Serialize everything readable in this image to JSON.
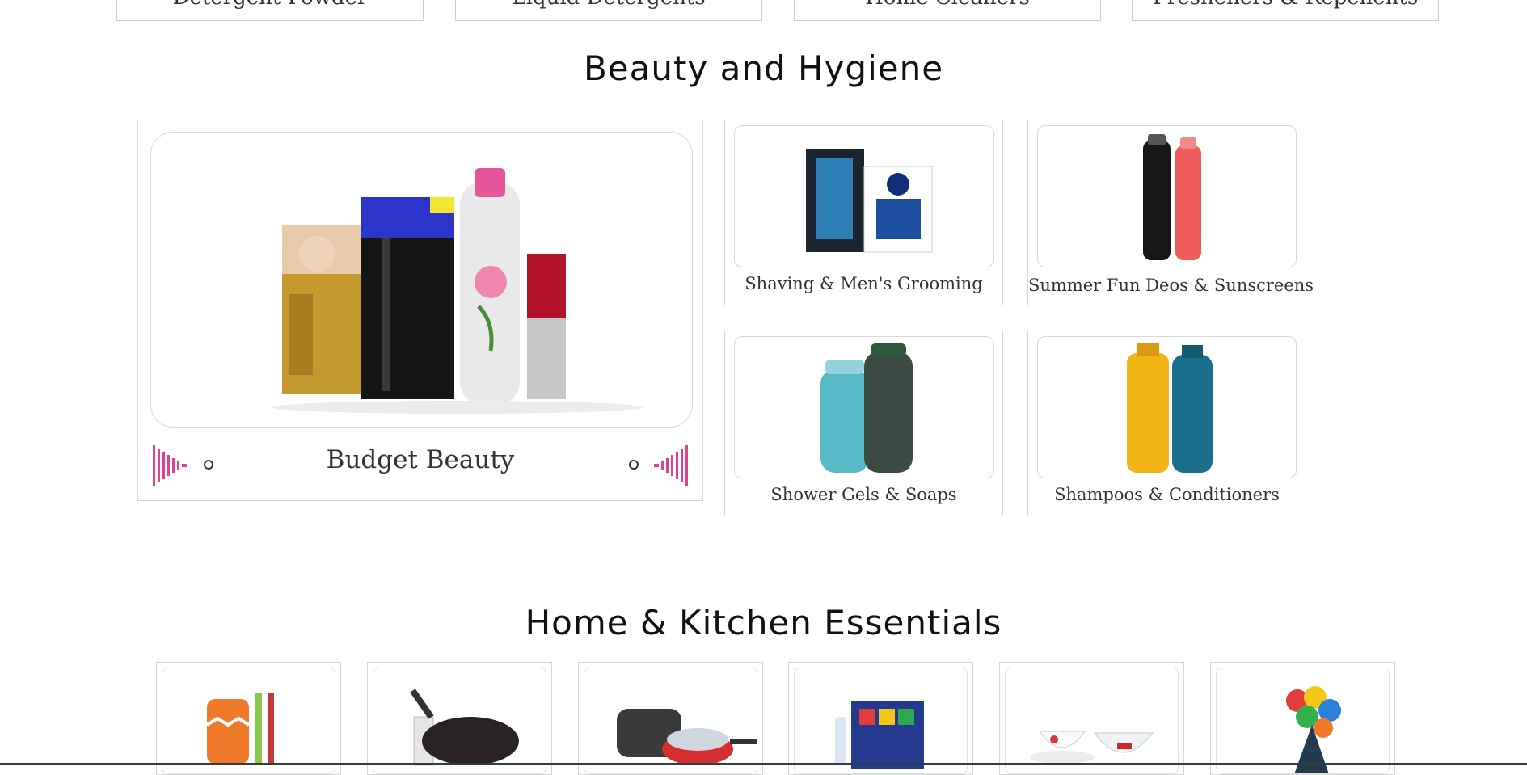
{
  "top_categories": [
    {
      "label": "Detergent Powder"
    },
    {
      "label": "Liquid Detergents"
    },
    {
      "label": "Home Cleaners"
    },
    {
      "label": "Fresheners & Repellents"
    }
  ],
  "beauty": {
    "title": "Beauty and Hygiene",
    "banner": {
      "label": "Budget Beauty"
    },
    "cards": [
      {
        "label": "Shaving & Men's Grooming"
      },
      {
        "label": "Summer Fun Deos & Sunscreens"
      },
      {
        "label": "Shower Gels & Soaps"
      },
      {
        "label": "Shampoos & Conditioners"
      }
    ]
  },
  "kitchen": {
    "title": "Home & Kitchen Essentials",
    "cards": [
      "kitchen-tools",
      "cookware-tawa",
      "pressure-cooker-set",
      "stationery",
      "cups-bowls",
      "party-balloons"
    ]
  },
  "colors": {
    "accent": "#e0408f",
    "border": "#d6d6d6",
    "text": "#333333"
  }
}
